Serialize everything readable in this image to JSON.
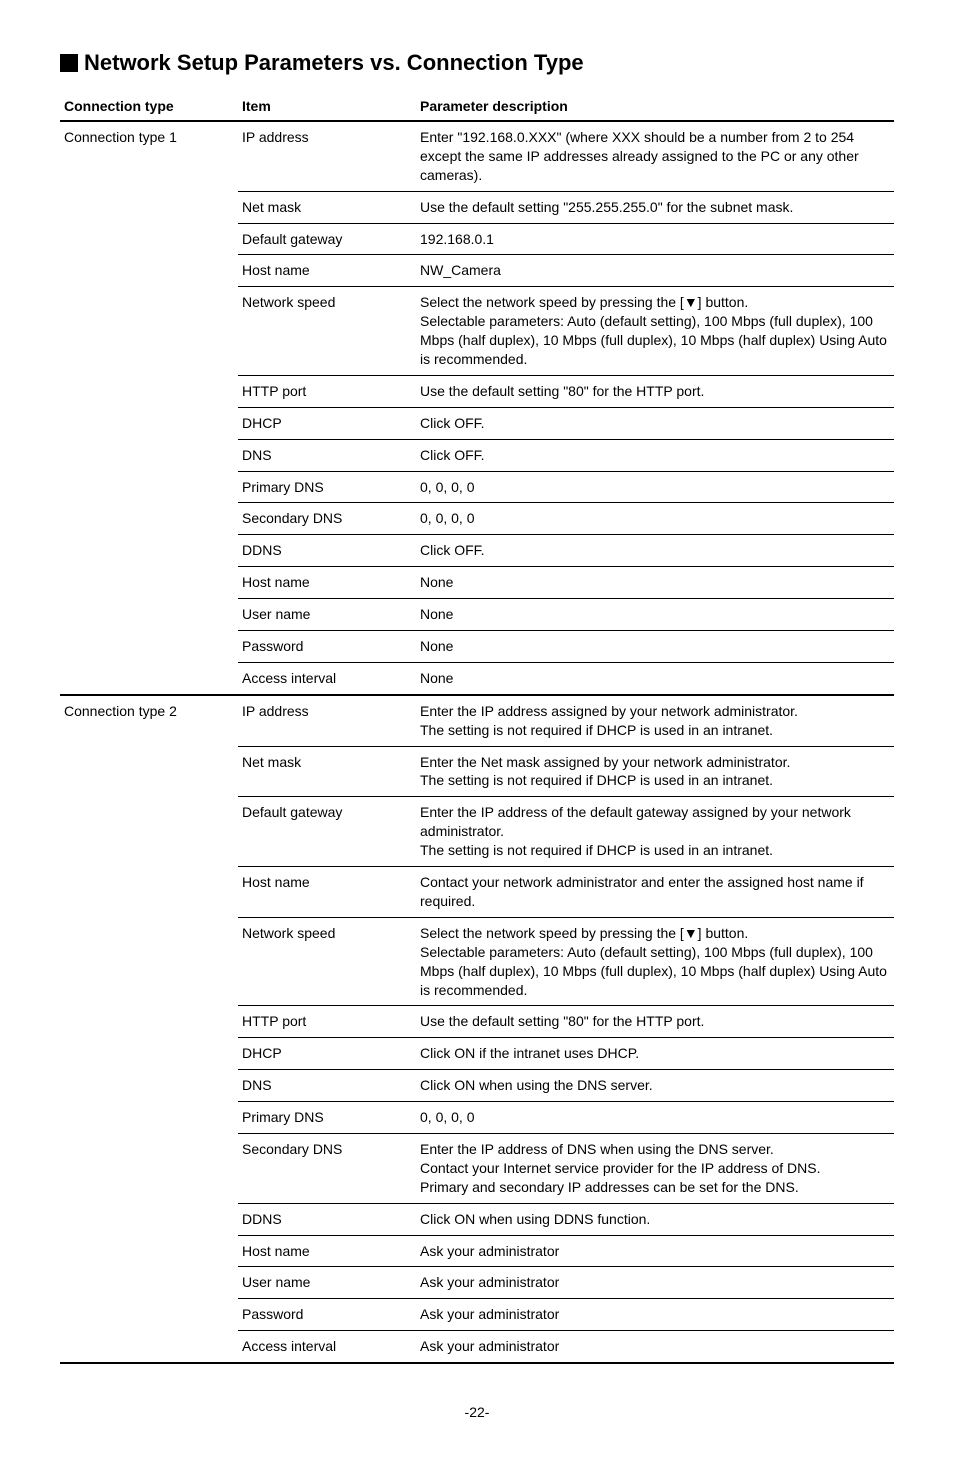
{
  "heading": "Network Setup Parameters vs. Connection Type",
  "columns": {
    "conn": "Connection type",
    "item": "Item",
    "desc": "Parameter description"
  },
  "groups": [
    {
      "label": "Connection type 1",
      "rows": [
        {
          "item": "IP address",
          "desc": "Enter \"192.168.0.XXX\" (where XXX should be a number from 2 to 254 except the same IP addresses already assigned to the PC or any other cameras)."
        },
        {
          "item": "Net mask",
          "desc": "Use the default setting \"255.255.255.0\" for the subnet mask."
        },
        {
          "item": "Default gateway",
          "desc": "192.168.0.1"
        },
        {
          "item": "Host name",
          "desc": "NW_Camera"
        },
        {
          "item": "Network speed",
          "desc": "Select the network speed by pressing the [▼] button.\nSelectable parameters: Auto (default setting), 100 Mbps (full duplex), 100 Mbps (half duplex), 10 Mbps (full duplex), 10 Mbps (half duplex)  Using Auto is recommended."
        },
        {
          "item": "HTTP port",
          "desc": "Use the default setting \"80\" for the HTTP port."
        },
        {
          "item": "DHCP",
          "desc": "Click OFF."
        },
        {
          "item": "DNS",
          "desc": "Click OFF."
        },
        {
          "item": "Primary DNS",
          "desc": "0, 0, 0, 0"
        },
        {
          "item": "Secondary DNS",
          "desc": "0, 0, 0, 0"
        },
        {
          "item": "DDNS",
          "desc": "Click OFF."
        },
        {
          "item": "Host name",
          "desc": "None"
        },
        {
          "item": "User name",
          "desc": "None"
        },
        {
          "item": "Password",
          "desc": "None"
        },
        {
          "item": "Access interval",
          "desc": "None"
        }
      ]
    },
    {
      "label": "Connection type 2",
      "rows": [
        {
          "item": "IP address",
          "desc": "Enter the IP address assigned by your network administrator.\nThe setting is not required if DHCP is used in an intranet."
        },
        {
          "item": "Net mask",
          "desc": "Enter the Net mask assigned by your network administrator.\nThe setting is not required if DHCP is used in an intranet."
        },
        {
          "item": "Default gateway",
          "desc": "Enter the IP address of the default gateway assigned by your network administrator.\nThe setting is not required if DHCP is used in an intranet."
        },
        {
          "item": "Host name",
          "desc": "Contact your network administrator and enter the assigned host name if required."
        },
        {
          "item": "Network speed",
          "desc": "Select the network speed by pressing the [▼] button.\nSelectable parameters: Auto (default setting), 100 Mbps (full duplex), 100 Mbps (half duplex), 10 Mbps (full duplex), 10 Mbps (half duplex) Using Auto is recommended."
        },
        {
          "item": "HTTP port",
          "desc": "Use the default setting \"80\" for the HTTP port."
        },
        {
          "item": "DHCP",
          "desc": "Click ON if the intranet uses DHCP."
        },
        {
          "item": "DNS",
          "desc": "Click ON when using the DNS server."
        },
        {
          "item": "Primary DNS",
          "desc": "0, 0, 0, 0"
        },
        {
          "item": "Secondary DNS",
          "desc": "Enter the IP address of DNS when using the DNS server.\nContact your Internet service provider for the IP address of DNS.\nPrimary and secondary IP addresses can be set for the DNS."
        },
        {
          "item": "DDNS",
          "desc": "Click ON when using DDNS function."
        },
        {
          "item": "Host name",
          "desc": "Ask your administrator"
        },
        {
          "item": "User name",
          "desc": "Ask your administrator"
        },
        {
          "item": "Password",
          "desc": "Ask your administrator"
        },
        {
          "item": "Access interval",
          "desc": "Ask your administrator"
        }
      ]
    }
  ],
  "page_number": "-22-"
}
